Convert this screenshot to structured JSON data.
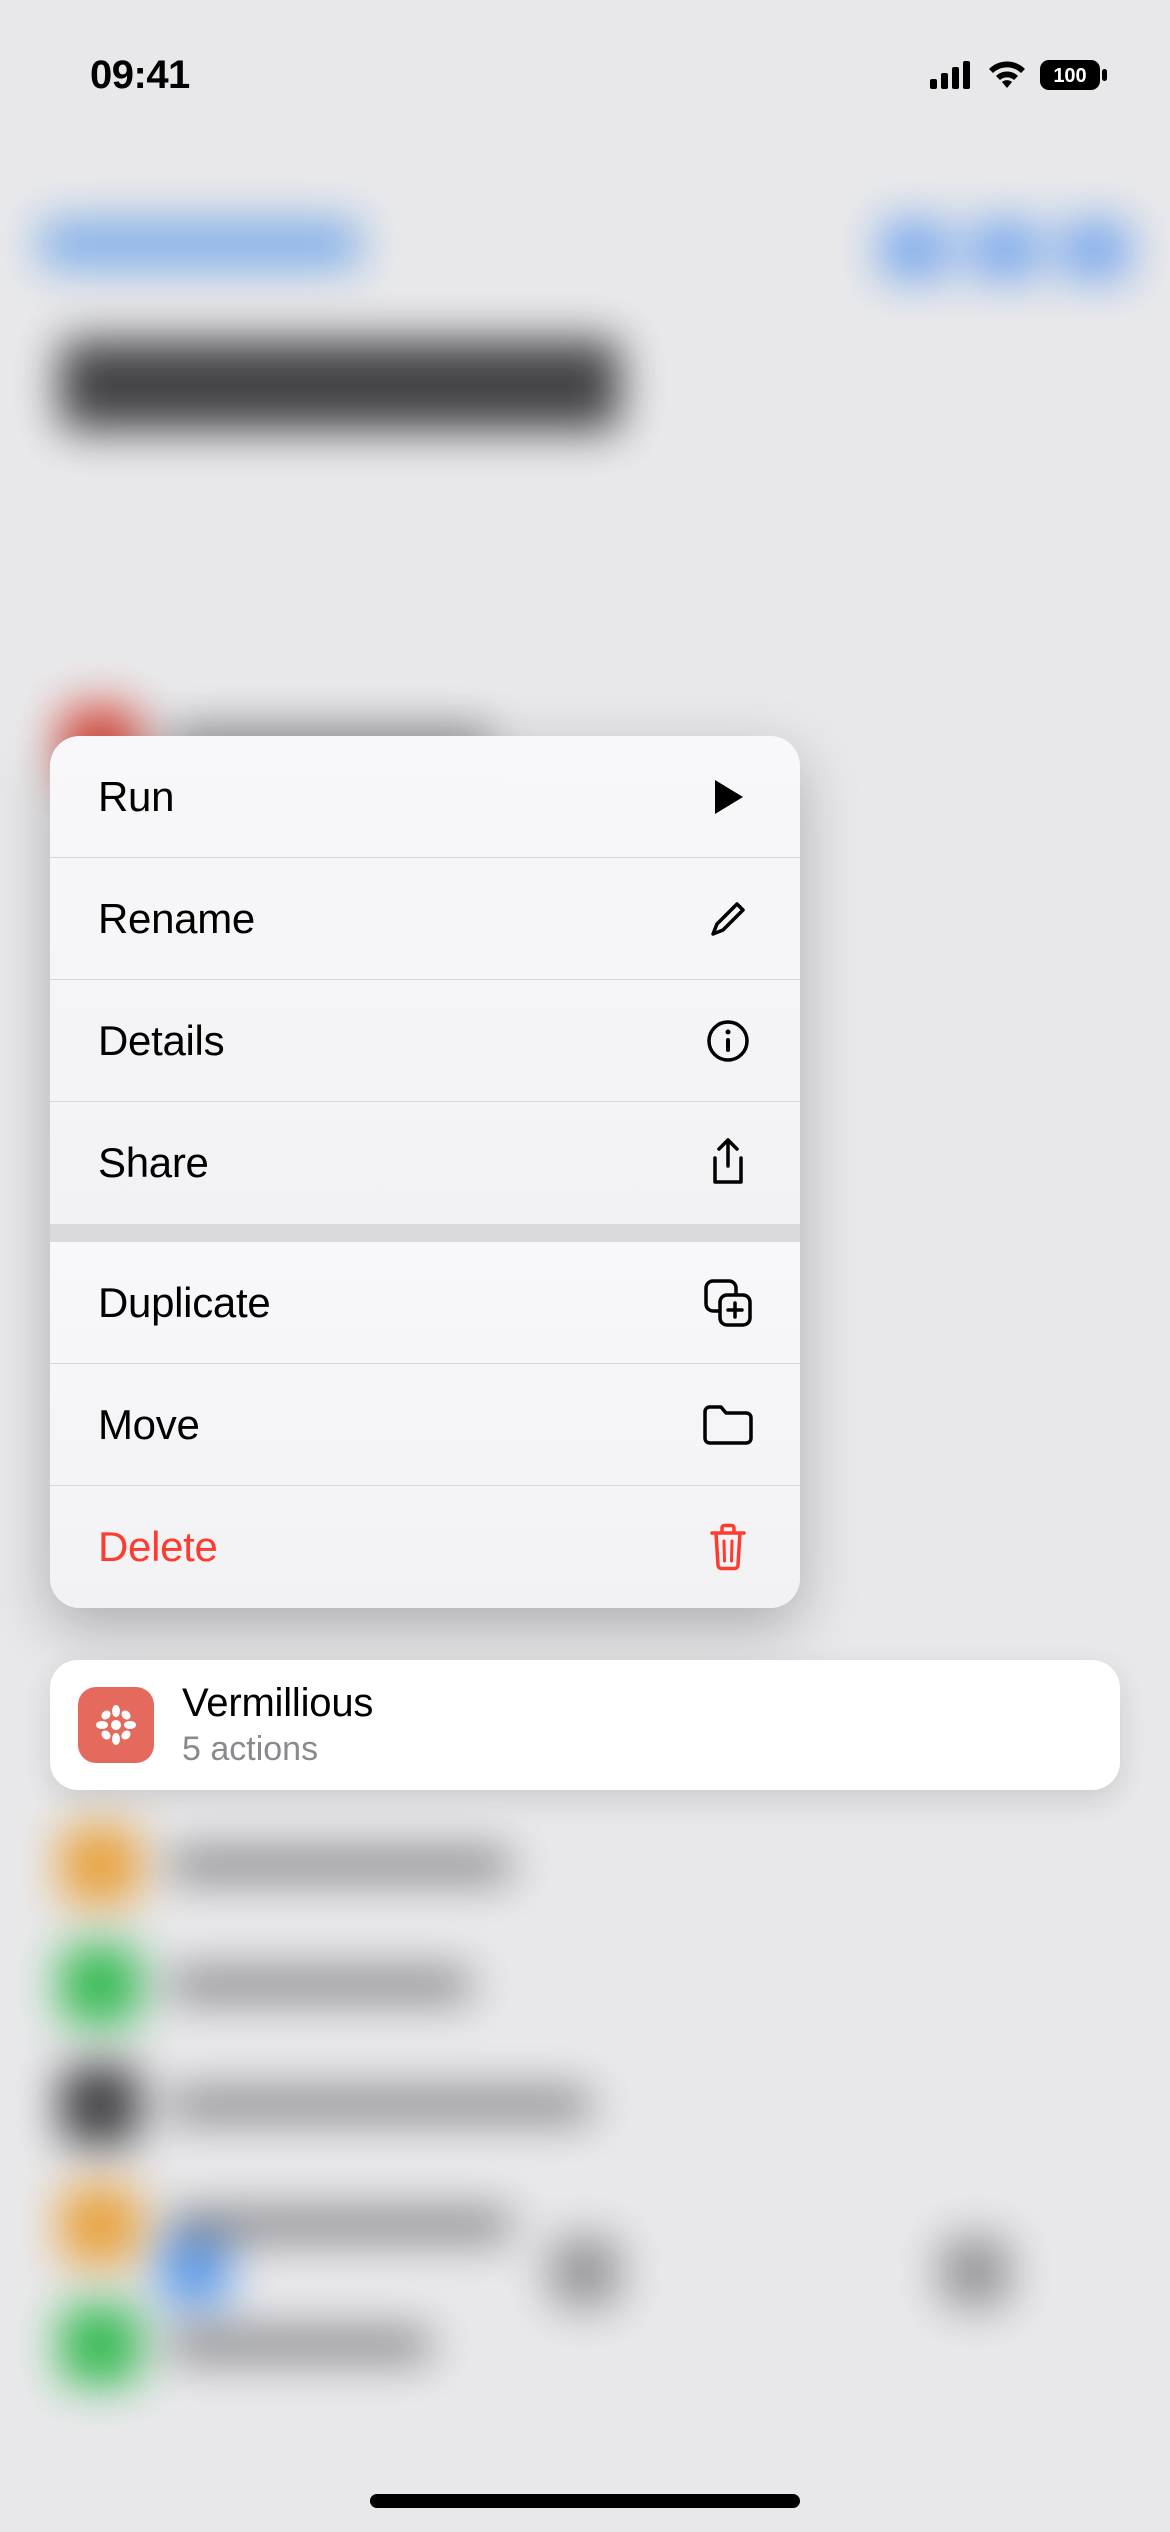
{
  "status_bar": {
    "time": "09:41",
    "battery": "100"
  },
  "context_menu": {
    "section1": [
      {
        "label": "Run",
        "icon": "play-icon"
      },
      {
        "label": "Rename",
        "icon": "pencil-icon"
      },
      {
        "label": "Details",
        "icon": "info-icon"
      },
      {
        "label": "Share",
        "icon": "share-icon"
      }
    ],
    "section2": [
      {
        "label": "Duplicate",
        "icon": "duplicate-icon"
      },
      {
        "label": "Move",
        "icon": "folder-icon"
      },
      {
        "label": "Delete",
        "icon": "trash-icon",
        "destructive": true
      }
    ]
  },
  "shortcut": {
    "title": "Vermillious",
    "subtitle": "5 actions",
    "icon_color": "#e46a5e"
  }
}
